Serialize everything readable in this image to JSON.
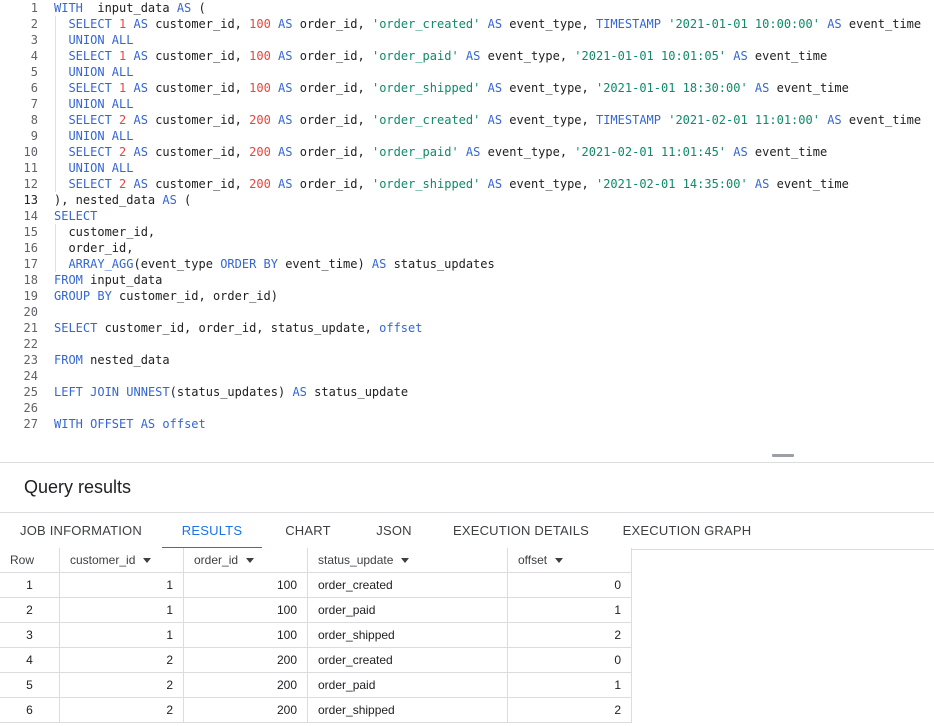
{
  "editor": {
    "lines": [
      {
        "n": "1",
        "segs": [
          [
            "kw",
            "WITH"
          ],
          [
            "",
            "  input_data "
          ],
          [
            "kw",
            "AS"
          ],
          [
            "",
            " ("
          ]
        ]
      },
      {
        "n": "2",
        "segs": [
          [
            "",
            "  "
          ],
          [
            "kw",
            "SELECT"
          ],
          [
            "",
            " "
          ],
          [
            "num",
            "1"
          ],
          [
            "",
            " "
          ],
          [
            "kw",
            "AS"
          ],
          [
            "",
            " customer_id, "
          ],
          [
            "num",
            "100"
          ],
          [
            "",
            " "
          ],
          [
            "kw",
            "AS"
          ],
          [
            "",
            " order_id, "
          ],
          [
            "str",
            "'order_created'"
          ],
          [
            "",
            " "
          ],
          [
            "kw",
            "AS"
          ],
          [
            "",
            " event_type, "
          ],
          [
            "kw",
            "TIMESTAMP"
          ],
          [
            "",
            " "
          ],
          [
            "str",
            "'2021-01-01 10:00:00'"
          ],
          [
            "",
            " "
          ],
          [
            "kw",
            "AS"
          ],
          [
            "",
            " event_time"
          ]
        ]
      },
      {
        "n": "3",
        "segs": [
          [
            "",
            "  "
          ],
          [
            "kw",
            "UNION ALL"
          ]
        ]
      },
      {
        "n": "4",
        "segs": [
          [
            "",
            "  "
          ],
          [
            "kw",
            "SELECT"
          ],
          [
            "",
            " "
          ],
          [
            "num",
            "1"
          ],
          [
            "",
            " "
          ],
          [
            "kw",
            "AS"
          ],
          [
            "",
            " customer_id, "
          ],
          [
            "num",
            "100"
          ],
          [
            "",
            " "
          ],
          [
            "kw",
            "AS"
          ],
          [
            "",
            " order_id, "
          ],
          [
            "str",
            "'order_paid'"
          ],
          [
            "",
            " "
          ],
          [
            "kw",
            "AS"
          ],
          [
            "",
            " event_type, "
          ],
          [
            "str",
            "'2021-01-01 10:01:05'"
          ],
          [
            "",
            " "
          ],
          [
            "kw",
            "AS"
          ],
          [
            "",
            " event_time"
          ]
        ]
      },
      {
        "n": "5",
        "segs": [
          [
            "",
            "  "
          ],
          [
            "kw",
            "UNION ALL"
          ]
        ]
      },
      {
        "n": "6",
        "segs": [
          [
            "",
            "  "
          ],
          [
            "kw",
            "SELECT"
          ],
          [
            "",
            " "
          ],
          [
            "num",
            "1"
          ],
          [
            "",
            " "
          ],
          [
            "kw",
            "AS"
          ],
          [
            "",
            " customer_id, "
          ],
          [
            "num",
            "100"
          ],
          [
            "",
            " "
          ],
          [
            "kw",
            "AS"
          ],
          [
            "",
            " order_id, "
          ],
          [
            "str",
            "'order_shipped'"
          ],
          [
            "",
            " "
          ],
          [
            "kw",
            "AS"
          ],
          [
            "",
            " event_type, "
          ],
          [
            "str",
            "'2021-01-01 18:30:00'"
          ],
          [
            "",
            " "
          ],
          [
            "kw",
            "AS"
          ],
          [
            "",
            " event_time"
          ]
        ]
      },
      {
        "n": "7",
        "segs": [
          [
            "",
            "  "
          ],
          [
            "kw",
            "UNION ALL"
          ]
        ]
      },
      {
        "n": "8",
        "segs": [
          [
            "",
            "  "
          ],
          [
            "kw",
            "SELECT"
          ],
          [
            "",
            " "
          ],
          [
            "num",
            "2"
          ],
          [
            "",
            " "
          ],
          [
            "kw",
            "AS"
          ],
          [
            "",
            " customer_id, "
          ],
          [
            "num",
            "200"
          ],
          [
            "",
            " "
          ],
          [
            "kw",
            "AS"
          ],
          [
            "",
            " order_id, "
          ],
          [
            "str",
            "'order_created'"
          ],
          [
            "",
            " "
          ],
          [
            "kw",
            "AS"
          ],
          [
            "",
            " event_type, "
          ],
          [
            "kw",
            "TIMESTAMP"
          ],
          [
            "",
            " "
          ],
          [
            "str",
            "'2021-02-01 11:01:00'"
          ],
          [
            "",
            " "
          ],
          [
            "kw",
            "AS"
          ],
          [
            "",
            " event_time"
          ]
        ]
      },
      {
        "n": "9",
        "segs": [
          [
            "",
            "  "
          ],
          [
            "kw",
            "UNION ALL"
          ]
        ]
      },
      {
        "n": "10",
        "segs": [
          [
            "",
            "  "
          ],
          [
            "kw",
            "SELECT"
          ],
          [
            "",
            " "
          ],
          [
            "num",
            "2"
          ],
          [
            "",
            " "
          ],
          [
            "kw",
            "AS"
          ],
          [
            "",
            " customer_id, "
          ],
          [
            "num",
            "200"
          ],
          [
            "",
            " "
          ],
          [
            "kw",
            "AS"
          ],
          [
            "",
            " order_id, "
          ],
          [
            "str",
            "'order_paid'"
          ],
          [
            "",
            " "
          ],
          [
            "kw",
            "AS"
          ],
          [
            "",
            " event_type, "
          ],
          [
            "str",
            "'2021-02-01 11:01:45'"
          ],
          [
            "",
            " "
          ],
          [
            "kw",
            "AS"
          ],
          [
            "",
            " event_time"
          ]
        ]
      },
      {
        "n": "11",
        "segs": [
          [
            "",
            "  "
          ],
          [
            "kw",
            "UNION ALL"
          ]
        ]
      },
      {
        "n": "12",
        "segs": [
          [
            "",
            "  "
          ],
          [
            "kw",
            "SELECT"
          ],
          [
            "",
            " "
          ],
          [
            "num",
            "2"
          ],
          [
            "",
            " "
          ],
          [
            "kw",
            "AS"
          ],
          [
            "",
            " customer_id, "
          ],
          [
            "num",
            "200"
          ],
          [
            "",
            " "
          ],
          [
            "kw",
            "AS"
          ],
          [
            "",
            " order_id, "
          ],
          [
            "str",
            "'order_shipped'"
          ],
          [
            "",
            " "
          ],
          [
            "kw",
            "AS"
          ],
          [
            "",
            " event_type, "
          ],
          [
            "str",
            "'2021-02-01 14:35:00'"
          ],
          [
            "",
            " "
          ],
          [
            "kw",
            "AS"
          ],
          [
            "",
            " event_time"
          ]
        ]
      },
      {
        "n": "13",
        "active": true,
        "segs": [
          [
            "",
            "), nested_data "
          ],
          [
            "kw",
            "AS"
          ],
          [
            "",
            " ("
          ]
        ]
      },
      {
        "n": "14",
        "segs": [
          [
            "kw",
            "SELECT"
          ]
        ]
      },
      {
        "n": "15",
        "segs": [
          [
            "",
            "  customer_id,"
          ]
        ]
      },
      {
        "n": "16",
        "segs": [
          [
            "",
            "  order_id,"
          ]
        ]
      },
      {
        "n": "17",
        "segs": [
          [
            "",
            "  "
          ],
          [
            "fn",
            "ARRAY_AGG"
          ],
          [
            "",
            "(event_type "
          ],
          [
            "kw",
            "ORDER BY"
          ],
          [
            "",
            " event_time) "
          ],
          [
            "kw",
            "AS"
          ],
          [
            "",
            " status_updates"
          ]
        ]
      },
      {
        "n": "18",
        "segs": [
          [
            "kw",
            "FROM"
          ],
          [
            "",
            " input_data"
          ]
        ]
      },
      {
        "n": "19",
        "segs": [
          [
            "kw",
            "GROUP BY"
          ],
          [
            "",
            " customer_id, order_id)"
          ]
        ]
      },
      {
        "n": "20",
        "segs": []
      },
      {
        "n": "21",
        "segs": [
          [
            "kw",
            "SELECT"
          ],
          [
            "",
            " customer_id, order_id, status_update, "
          ],
          [
            "kw",
            "offset"
          ]
        ]
      },
      {
        "n": "22",
        "segs": []
      },
      {
        "n": "23",
        "segs": [
          [
            "kw",
            "FROM"
          ],
          [
            "",
            " nested_data"
          ]
        ]
      },
      {
        "n": "24",
        "segs": []
      },
      {
        "n": "25",
        "segs": [
          [
            "kw",
            "LEFT JOIN"
          ],
          [
            "",
            " "
          ],
          [
            "fn",
            "UNNEST"
          ],
          [
            "",
            "(status_updates) "
          ],
          [
            "kw",
            "AS"
          ],
          [
            "",
            " status_update"
          ]
        ]
      },
      {
        "n": "26",
        "segs": []
      },
      {
        "n": "27",
        "segs": [
          [
            "kw",
            "WITH OFFSET AS"
          ],
          [
            "",
            " "
          ],
          [
            "kw",
            "offset"
          ]
        ]
      }
    ]
  },
  "results": {
    "title": "Query results",
    "tabs": [
      "JOB INFORMATION",
      "RESULTS",
      "CHART",
      "JSON",
      "EXECUTION DETAILS",
      "EXECUTION GRAPH"
    ],
    "active_tab": "RESULTS",
    "columns": [
      "Row",
      "customer_id",
      "order_id",
      "status_update",
      "offset"
    ],
    "rows": [
      [
        "1",
        "1",
        "100",
        "order_created",
        "0"
      ],
      [
        "2",
        "1",
        "100",
        "order_paid",
        "1"
      ],
      [
        "3",
        "1",
        "100",
        "order_shipped",
        "2"
      ],
      [
        "4",
        "2",
        "200",
        "order_created",
        "0"
      ],
      [
        "5",
        "2",
        "200",
        "order_paid",
        "1"
      ],
      [
        "6",
        "2",
        "200",
        "order_shipped",
        "2"
      ]
    ]
  }
}
